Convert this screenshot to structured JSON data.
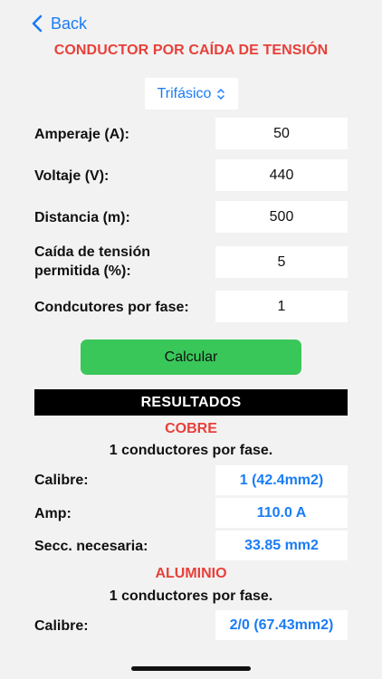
{
  "nav": {
    "back_label": "Back"
  },
  "page": {
    "title": "CONDUCTOR POR CAÍDA DE TENSIÓN"
  },
  "phase_select": {
    "value": "Trifásico"
  },
  "inputs": {
    "amperaje": {
      "label": "Amperaje (A):",
      "value": "50"
    },
    "voltaje": {
      "label": "Voltaje (V):",
      "value": "440"
    },
    "distancia": {
      "label": "Distancia (m):",
      "value": "500"
    },
    "caida": {
      "label_line1": "Caída de tensión",
      "label_line2": "permitida (%):",
      "value": "5"
    },
    "conductores": {
      "label": "Condcutores por fase:",
      "value": "1"
    }
  },
  "actions": {
    "calcular_label": "Calcular"
  },
  "results": {
    "header": "RESULTADOS",
    "cobre": {
      "title": "COBRE",
      "note": "1 conductores por fase.",
      "calibre_label": "Calibre:",
      "calibre_value": "1 (42.4mm2)",
      "amp_label": "Amp:",
      "amp_value": "110.0 A",
      "secc_label": "Secc. necesaria:",
      "secc_value": "33.85 mm2"
    },
    "aluminio": {
      "title": "ALUMINIO",
      "note": "1 conductores por fase.",
      "calibre_label": "Calibre:",
      "calibre_value": "2/0 (67.43mm2)"
    }
  },
  "colors": {
    "accent_blue": "#1a7cf5",
    "title_red": "#e8403a",
    "button_green": "#3ac75a"
  }
}
